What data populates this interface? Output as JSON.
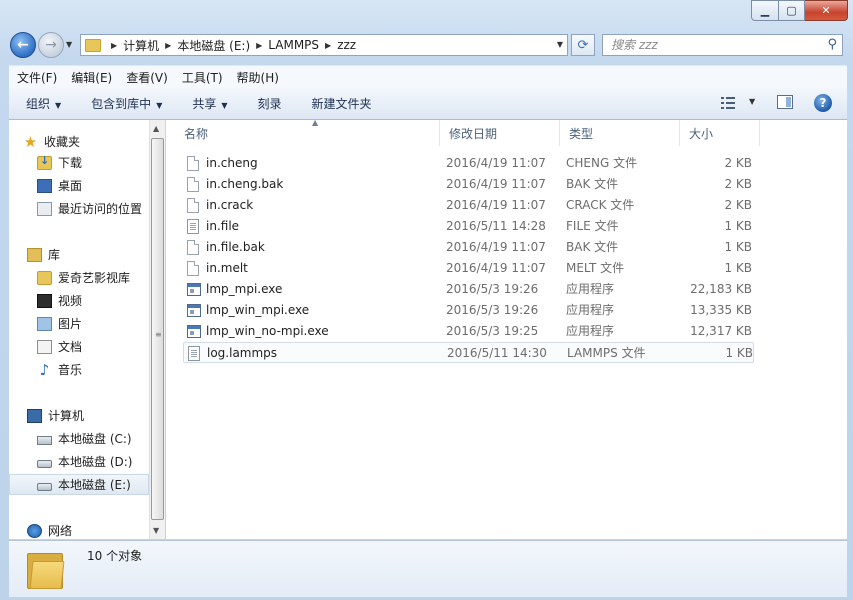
{
  "navigation": {
    "breadcrumbs": [
      "计算机",
      "本地磁盘 (E:)",
      "LAMMPS",
      "zzz"
    ],
    "search_placeholder": "搜索 zzz"
  },
  "menu": [
    "文件(F)",
    "编辑(E)",
    "查看(V)",
    "工具(T)",
    "帮助(H)"
  ],
  "commands": {
    "organize": "组织",
    "include_in_library": "包含到库中",
    "share": "共享",
    "burn": "刻录",
    "new_folder": "新建文件夹"
  },
  "nav_pane": {
    "favorites_header": "收藏夹",
    "favorites": [
      "下载",
      "桌面",
      "最近访问的位置"
    ],
    "libraries_header": "库",
    "libraries": [
      "爱奇艺影视库",
      "视频",
      "图片",
      "文档",
      "音乐"
    ],
    "computer_header": "计算机",
    "drives": [
      "本地磁盘 (C:)",
      "本地磁盘 (D:)",
      "本地磁盘 (E:)"
    ],
    "selected_drive": "本地磁盘 (E:)",
    "network_header": "网络"
  },
  "columns": [
    "名称",
    "修改日期",
    "类型",
    "大小"
  ],
  "files": [
    {
      "name": "in.cheng",
      "date": "2016/4/19 11:07",
      "type": "CHENG 文件",
      "size": "2 KB",
      "icon": "document-icon"
    },
    {
      "name": "in.cheng.bak",
      "date": "2016/4/19 11:07",
      "type": "BAK 文件",
      "size": "2 KB",
      "icon": "document-icon"
    },
    {
      "name": "in.crack",
      "date": "2016/4/19 11:07",
      "type": "CRACK 文件",
      "size": "2 KB",
      "icon": "document-icon"
    },
    {
      "name": "in.file",
      "date": "2016/5/11 14:28",
      "type": "FILE 文件",
      "size": "1 KB",
      "icon": "text-file-icon"
    },
    {
      "name": "in.file.bak",
      "date": "2016/4/19 11:07",
      "type": "BAK 文件",
      "size": "1 KB",
      "icon": "document-icon"
    },
    {
      "name": "in.melt",
      "date": "2016/4/19 11:07",
      "type": "MELT 文件",
      "size": "1 KB",
      "icon": "document-icon"
    },
    {
      "name": "lmp_mpi.exe",
      "date": "2016/5/3 19:26",
      "type": "应用程序",
      "size": "22,183 KB",
      "icon": "application-icon"
    },
    {
      "name": "lmp_win_mpi.exe",
      "date": "2016/5/3 19:26",
      "type": "应用程序",
      "size": "13,335 KB",
      "icon": "application-icon"
    },
    {
      "name": "lmp_win_no-mpi.exe",
      "date": "2016/5/3 19:25",
      "type": "应用程序",
      "size": "12,317 KB",
      "icon": "application-icon"
    },
    {
      "name": "log.lammps",
      "date": "2016/5/11 14:30",
      "type": "LAMMPS 文件",
      "size": "1 KB",
      "icon": "text-file-icon"
    }
  ],
  "selected_file": "log.lammps",
  "status": {
    "item_count": "10 个对象"
  }
}
